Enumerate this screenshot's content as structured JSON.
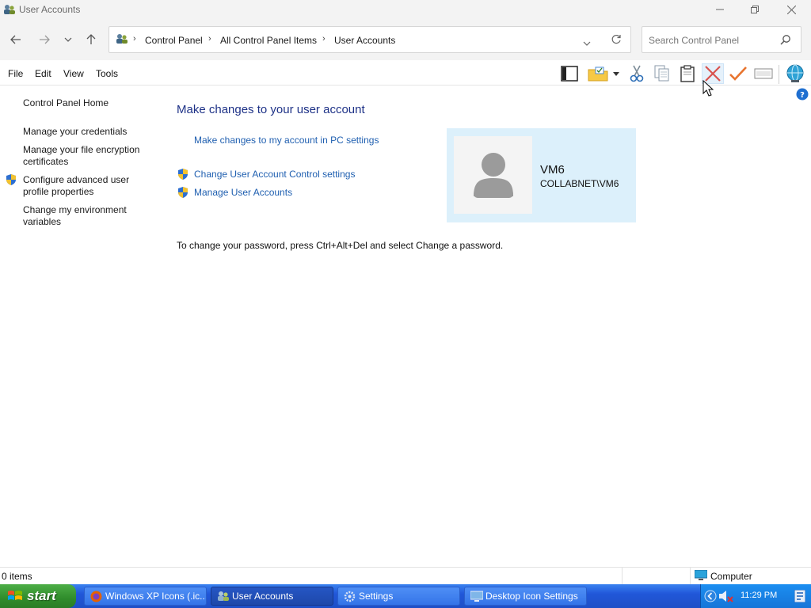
{
  "window": {
    "title": "User Accounts"
  },
  "address": {
    "crumbs": [
      "Control Panel",
      "All Control Panel Items",
      "User Accounts"
    ],
    "search_placeholder": "Search Control Panel"
  },
  "menu": {
    "items": [
      "File",
      "Edit",
      "View",
      "Tools"
    ]
  },
  "toolbar": {
    "icons": [
      "pane-icon",
      "folder-check-icon",
      "dropdown-icon",
      "cut-icon",
      "copy-icon",
      "paste-icon",
      "delete-icon",
      "check-icon",
      "rename-icon",
      "globe-icon",
      "help-icon"
    ]
  },
  "sidebar": {
    "items": [
      {
        "label": "Control Panel Home"
      },
      {
        "label": "Manage your credentials"
      },
      {
        "label": "Manage your file encryption certificates"
      },
      {
        "label": "Configure advanced user profile properties"
      },
      {
        "label": "Change my environment variables"
      }
    ]
  },
  "main": {
    "heading": "Make changes to your user account",
    "links": [
      {
        "label": "Make changes to my account in PC settings"
      },
      {
        "label": "Change User Account Control settings"
      },
      {
        "label": "Manage User Accounts"
      }
    ],
    "account": {
      "name": "VM6",
      "domain": "COLLABNET\\VM6"
    },
    "password_note": "To change your password, press Ctrl+Alt+Del and select Change a password."
  },
  "status": {
    "left": "0 items",
    "right": "Computer"
  },
  "taskbar": {
    "start": "start",
    "buttons": [
      {
        "label": "Windows XP Icons (.ic..."
      },
      {
        "label": "User Accounts"
      },
      {
        "label": "Settings"
      },
      {
        "label": "Desktop Icon Settings"
      }
    ],
    "clock": "11:29 PM"
  },
  "colors": {
    "link": "#1f5fb0",
    "heading": "#1e3287",
    "card": "#dcf0fb",
    "taskbar": "#2157d9",
    "start": "#2f8c2b"
  }
}
